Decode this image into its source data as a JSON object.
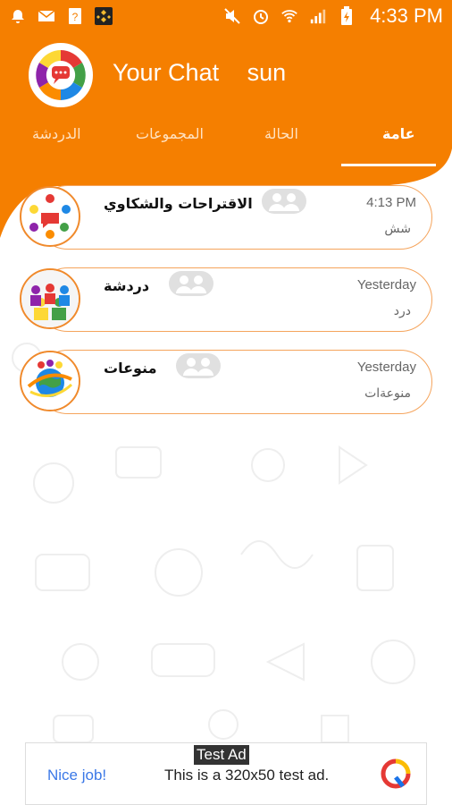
{
  "status_bar": {
    "time": "4:33 PM",
    "left_icons": [
      "notification-bell-icon",
      "mail-icon",
      "question-file-icon",
      "binance-icon"
    ],
    "right_icons": [
      "mute-icon",
      "alarm-icon",
      "wifi-hotspot-icon",
      "signal-icon",
      "battery-charging-icon"
    ]
  },
  "header": {
    "app_name": "Your Chat",
    "user_name": "sun",
    "accent_color": "#f57f00"
  },
  "tabs": [
    {
      "label": "عامة",
      "active": true
    },
    {
      "label": "الحالة",
      "active": false
    },
    {
      "label": "المجموعات",
      "active": false
    },
    {
      "label": "الدردشة",
      "active": false
    }
  ],
  "chats": [
    {
      "name": "الاقتراحات والشكاوي",
      "time": "4:13 PM",
      "last_message": "شش",
      "avatar": "colorful-people-circle-icon"
    },
    {
      "name": "دردشة",
      "time": "Yesterday",
      "last_message": "درد",
      "avatar": "group-people-icon"
    },
    {
      "name": "منوعات",
      "time": "Yesterday",
      "last_message": "منوعةات",
      "avatar": "globe-people-icon"
    }
  ],
  "ad": {
    "label": "Test Ad",
    "headline": "Nice job!",
    "body": "This is a 320x50 test ad.",
    "logo": "ad-choices-logo-icon"
  }
}
